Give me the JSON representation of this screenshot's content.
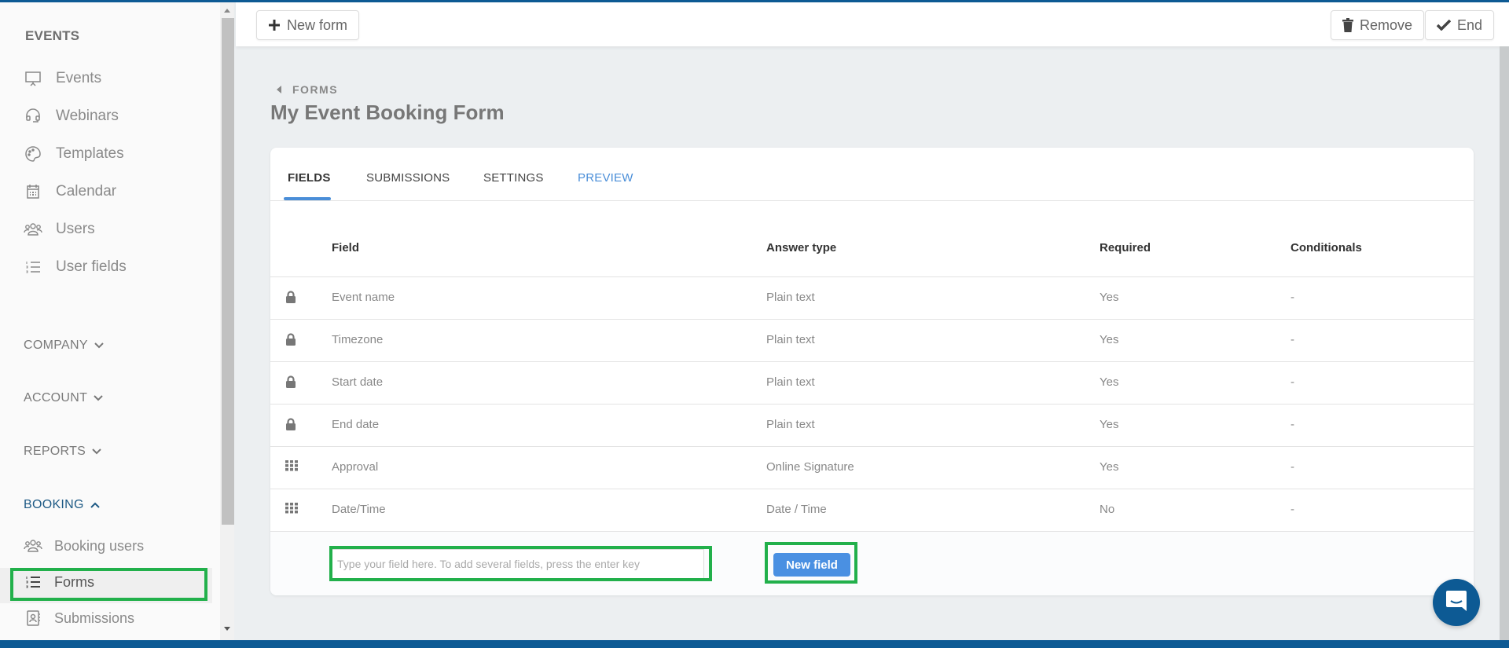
{
  "sidebar": {
    "events_heading": "EVENTS",
    "items": [
      {
        "label": "Events",
        "icon": "presentation-icon"
      },
      {
        "label": "Webinars",
        "icon": "headset-icon"
      },
      {
        "label": "Templates",
        "icon": "palette-icon"
      },
      {
        "label": "Calendar",
        "icon": "calendar-icon"
      },
      {
        "label": "Users",
        "icon": "users-icon"
      },
      {
        "label": "User fields",
        "icon": "numbered-list-icon"
      }
    ],
    "sections": [
      {
        "label": "COMPANY",
        "expanded": false
      },
      {
        "label": "ACCOUNT",
        "expanded": false
      },
      {
        "label": "REPORTS",
        "expanded": false
      },
      {
        "label": "BOOKING",
        "expanded": true
      }
    ],
    "booking_items": [
      {
        "label": "Booking users",
        "icon": "users-icon"
      },
      {
        "label": "Forms",
        "icon": "numbered-list-icon",
        "active": true
      },
      {
        "label": "Submissions",
        "icon": "contact-card-icon"
      }
    ]
  },
  "header": {
    "new_form_label": "New form",
    "remove_label": "Remove",
    "end_label": "End"
  },
  "page": {
    "breadcrumb": "FORMS",
    "title": "My Event Booking Form"
  },
  "tabs": [
    {
      "label": "FIELDS",
      "active": true
    },
    {
      "label": "SUBMISSIONS"
    },
    {
      "label": "SETTINGS"
    },
    {
      "label": "PREVIEW"
    }
  ],
  "table": {
    "headers": [
      "Field",
      "Answer type",
      "Required",
      "Conditionals"
    ],
    "rows": [
      {
        "icon": "lock-icon",
        "field": "Event name",
        "answer_type": "Plain text",
        "required": "Yes",
        "conditionals": "-"
      },
      {
        "icon": "lock-icon",
        "field": "Timezone",
        "answer_type": "Plain text",
        "required": "Yes",
        "conditionals": "-"
      },
      {
        "icon": "lock-icon",
        "field": "Start date",
        "answer_type": "Plain text",
        "required": "Yes",
        "conditionals": "-"
      },
      {
        "icon": "lock-icon",
        "field": "End date",
        "answer_type": "Plain text",
        "required": "Yes",
        "conditionals": "-"
      },
      {
        "icon": "drag-grid-icon",
        "field": "Approval",
        "answer_type": "Online Signature",
        "required": "Yes",
        "conditionals": "-"
      },
      {
        "icon": "drag-grid-icon",
        "field": "Date/Time",
        "answer_type": "Date / Time",
        "required": "No",
        "conditionals": "-"
      }
    ]
  },
  "add_field": {
    "value": "",
    "placeholder": "Type your field here. To add several fields, press the enter key",
    "button_label": "New field"
  },
  "colors": {
    "brand": "#0d5a94",
    "accent": "#4a90e2",
    "highlight": "#22b04b"
  }
}
